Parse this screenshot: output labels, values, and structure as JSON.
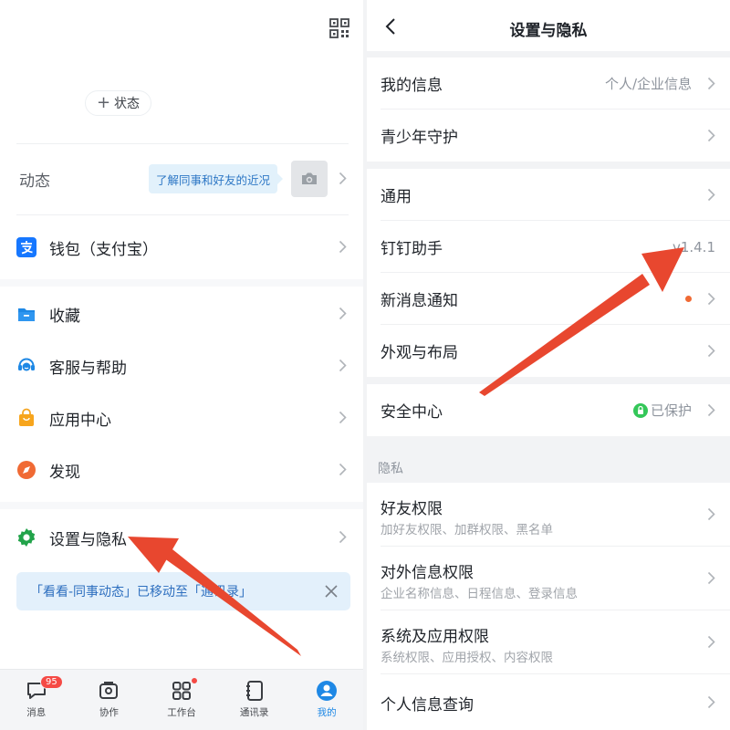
{
  "left": {
    "status_chip": {
      "plus": "+",
      "label": "状态"
    },
    "feed": {
      "label": "动态",
      "tip": "了解同事和好友的近况"
    },
    "menu": [
      {
        "label": "钱包（支付宝）",
        "icon": "alipay-icon"
      },
      {
        "label": "收藏",
        "icon": "favorites-folder-icon"
      },
      {
        "label": "客服与帮助",
        "icon": "customer-service-icon"
      },
      {
        "label": "应用中心",
        "icon": "app-center-bag-icon"
      },
      {
        "label": "发现",
        "icon": "discover-compass-icon"
      },
      {
        "label": "设置与隐私",
        "icon": "gear-icon"
      }
    ],
    "notice": "「看看-同事动态」已移动至「通讯录」",
    "tabs": [
      {
        "label": "消息",
        "badge": "95",
        "icon": "chat-bubble-icon"
      },
      {
        "label": "协作",
        "icon": "collaboration-icon"
      },
      {
        "label": "工作台",
        "icon": "grid-icon"
      },
      {
        "label": "通讯录",
        "icon": "contacts-book-icon"
      },
      {
        "label": "我的",
        "icon": "profile-person-icon",
        "active": true
      }
    ]
  },
  "right": {
    "nav": {
      "title": "设置与隐私"
    },
    "group1": [
      {
        "label": "我的信息",
        "value": "个人/企业信息"
      },
      {
        "label": "青少年守护",
        "value": ""
      }
    ],
    "group2": [
      {
        "label": "通用",
        "value": ""
      },
      {
        "label": "钉钉助手",
        "value": "v1.4.1"
      },
      {
        "label": "新消息通知",
        "value": ""
      },
      {
        "label": "外观与布局",
        "value": ""
      }
    ],
    "group3": [
      {
        "label": "安全中心",
        "value": "已保护"
      }
    ],
    "privacy_caption": "隐私",
    "privacy": [
      {
        "label": "好友权限",
        "sub": "加好友权限、加群权限、黑名单"
      },
      {
        "label": "对外信息权限",
        "sub": "企业名称信息、日程信息、登录信息"
      },
      {
        "label": "系统及应用权限",
        "sub": "系统权限、应用授权、内容权限"
      }
    ],
    "last_row": {
      "label": "个人信息查询"
    }
  },
  "colors": {
    "accent_blue": "#1e88e5",
    "annotation_arrow": "#e8472f",
    "badge_red": "#f54a45",
    "safe_green": "#34c759"
  }
}
